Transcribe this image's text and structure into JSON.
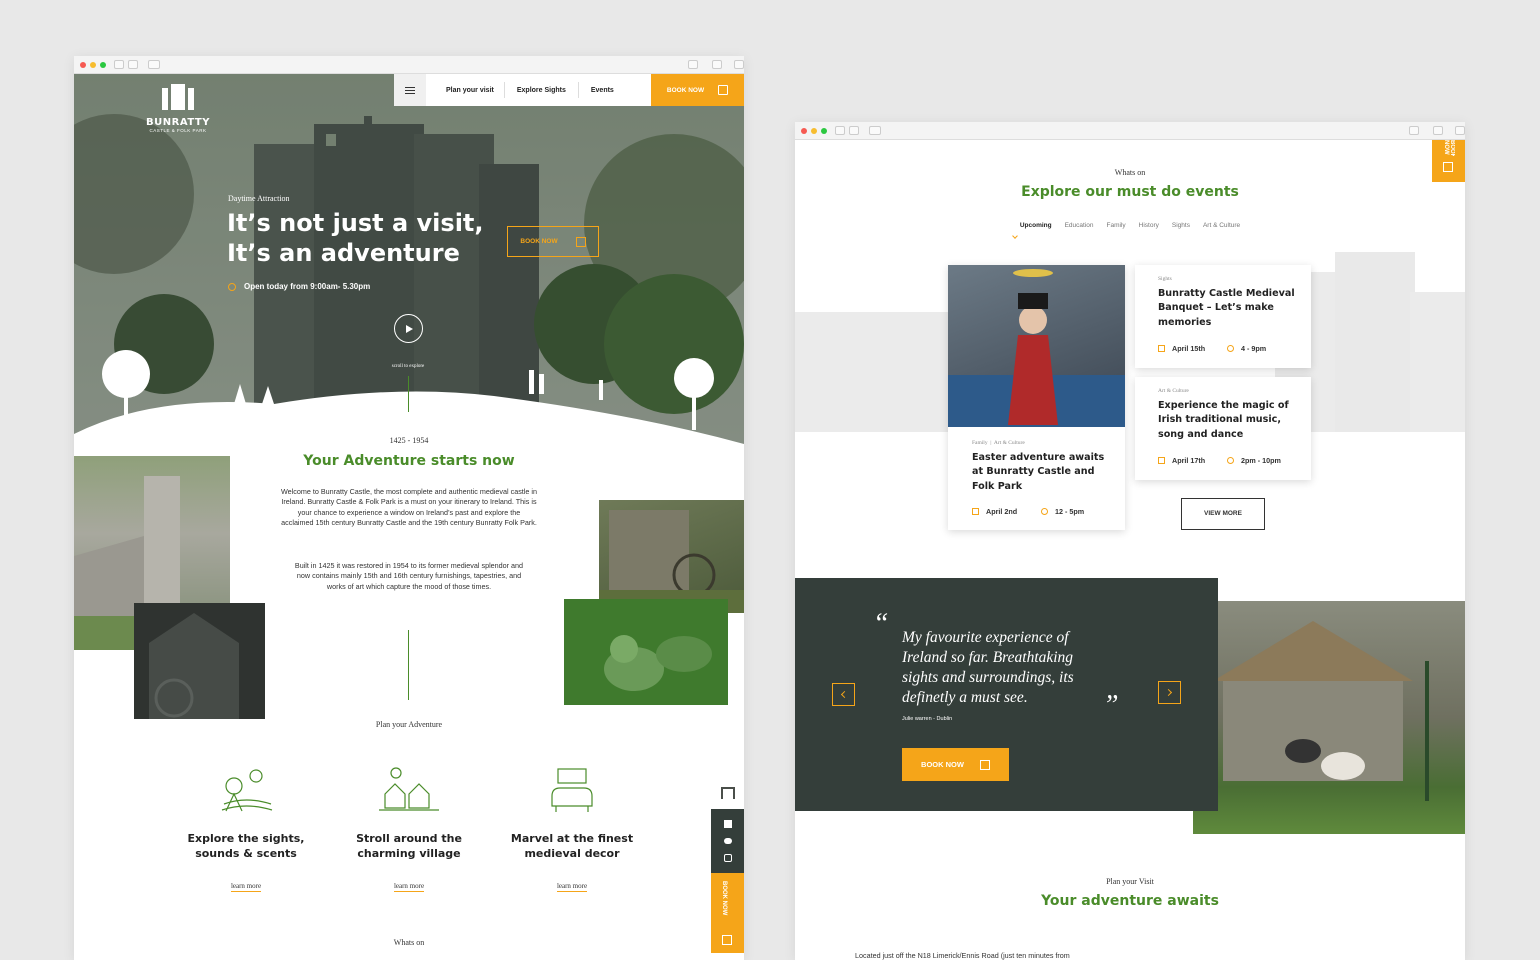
{
  "left": {
    "brand": {
      "logo_name": "BUNRATTY",
      "logo_sub": "CASTLE & FOLK PARK"
    },
    "nav": {
      "items": [
        "Plan your visit",
        "Explore Sights",
        "Events"
      ],
      "book": "BOOK NOW"
    },
    "hero": {
      "kicker": "Daytime Attraction",
      "title_line1": "It’s not just a visit,",
      "title_line2": "It’s an adventure",
      "hours": "Open today from 9:00am- 5.30pm",
      "book": "BOOK NOW",
      "scroll": "scroll to explore"
    },
    "intro": {
      "years": "1425 - 1954",
      "title": "Your Adventure starts now",
      "p1": "Welcome to Bunratty Castle, the most complete and authentic medieval castle in Ireland. Bunratty Castle & Folk Park is a must on your itinerary to Ireland. This is your chance to experience a window on Ireland’s past and explore the acclaimed 15th century Bunratty Castle and the 19th century Bunratty Folk Park.",
      "p2": "Built in 1425 it was restored in 1954 to its former medieval splendor and now contains mainly 15th and 16th century furnishings, tapestries, and works of art which capture the mood of those times."
    },
    "plan": {
      "label": "Plan your Adventure",
      "features": [
        {
          "line1": "Explore the sights,",
          "line2": "sounds & scents",
          "link": "learn more"
        },
        {
          "line1": "Stroll around the",
          "line2": "charming village",
          "link": "learn more"
        },
        {
          "line1": "Marvel at the finest",
          "line2": "medieval decor",
          "link": "learn more"
        }
      ]
    },
    "whats_on": "Whats on",
    "sidebar_book": "BOOK NOW"
  },
  "right": {
    "whats_on": "Whats on",
    "title": "Explore our must do events",
    "tabs": [
      "Upcoming",
      "Education",
      "Family",
      "History",
      "Sights",
      "Art & Culture"
    ],
    "active_tab": "Upcoming",
    "corner_book": "BOOK NOW",
    "events": [
      {
        "cats": [
          "Family",
          "Art & Culture"
        ],
        "title": "Easter adventure awaits at Bunratty Castle and Folk Park",
        "date": "April 2nd",
        "time": "12 - 5pm"
      },
      {
        "cats": [
          "Sights"
        ],
        "title": "Bunratty Castle Medieval Banquet – Let’s make memories",
        "date": "April 15th",
        "time": "4 - 9pm"
      },
      {
        "cats": [
          "Art & Culture"
        ],
        "title": "Experience the magic of Irish traditional music, song and dance",
        "date": "April 17th",
        "time": "2pm - 10pm"
      }
    ],
    "view_more": "VIEW MORE",
    "testimonial": {
      "quote_line1": "My favourite experience of",
      "quote_line2": "Ireland so far. Breathtaking",
      "quote_line3": "sights and surroundings, its",
      "quote_line4": "definetly a must see.",
      "author": "Julie warren - Dublin",
      "book": "BOOK NOW"
    },
    "plan": {
      "label": "Plan your Visit",
      "title": "Your adventure awaits",
      "text": "Located just off the N18 Limerick/Ennis Road (just ten minutes from"
    }
  },
  "colors": {
    "green": "#4a8c2a",
    "orange": "#f5a519",
    "dark_panel": "#343e3a"
  }
}
